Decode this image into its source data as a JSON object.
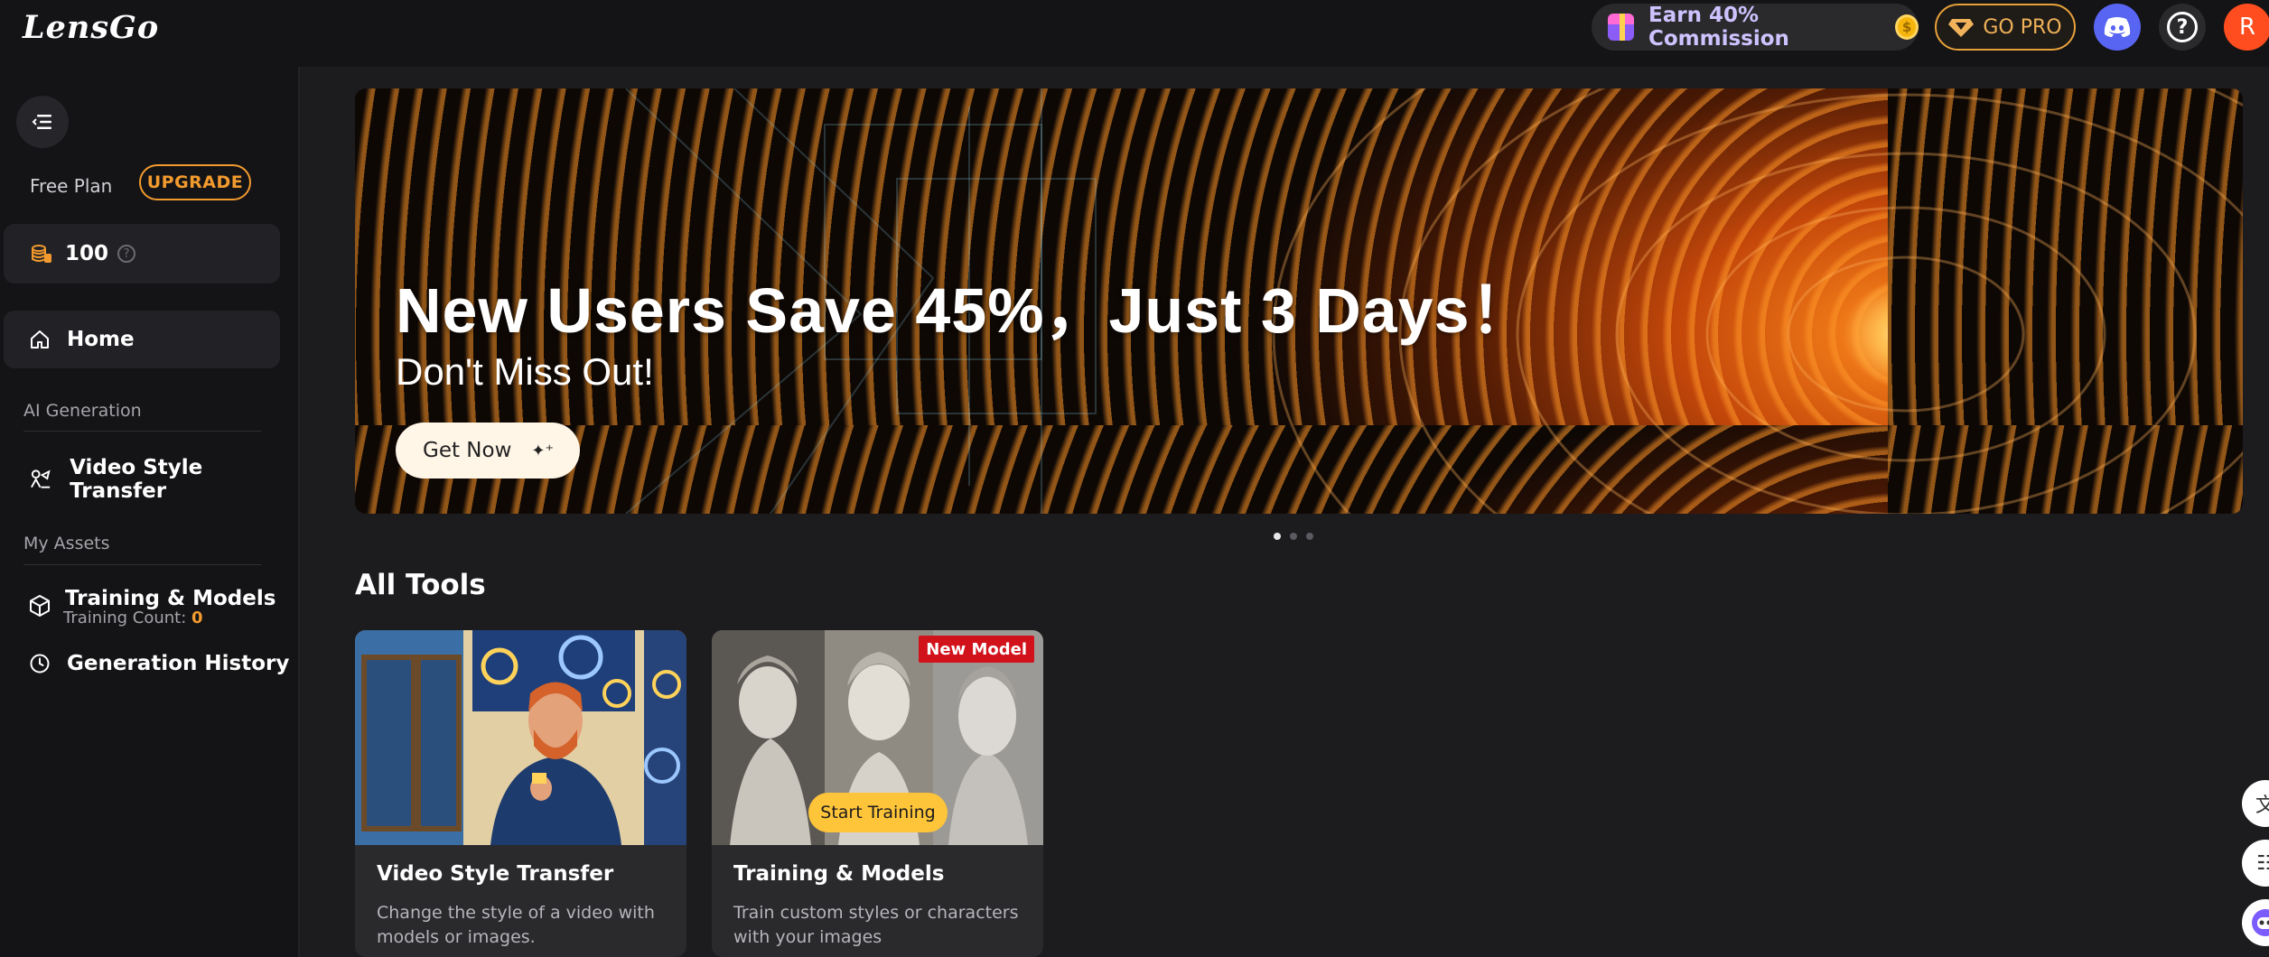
{
  "header": {
    "logo": "LensGo",
    "earn_label": "Earn 40% Commission",
    "gopro_label": "GO PRO",
    "avatar_initial": "R"
  },
  "sidebar": {
    "plan_label": "Free Plan",
    "upgrade_label": "UPGRADE",
    "credits": "100",
    "home_label": "Home",
    "section_ai": "AI Generation",
    "video_style_label": "Video Style Transfer",
    "section_assets": "My Assets",
    "training_label": "Training & Models",
    "training_count_label": "Training Count:",
    "training_count": "0",
    "history_label": "Generation History"
  },
  "banner": {
    "title": "New Users Save 45%，Just 3 Days！",
    "subtitle": "Don't Miss Out!",
    "cta_label": "Get Now",
    "slides": 3,
    "active_slide": 1
  },
  "tools": {
    "heading": "All Tools",
    "cards": [
      {
        "title": "Video Style Transfer",
        "description": "Change the style of a video with models or images."
      },
      {
        "title": "Training & Models",
        "description": "Train custom styles or characters with your images",
        "badge": "New Model",
        "overlay_button": "Start Training"
      }
    ]
  },
  "colors": {
    "accent_orange": "#f29a2e",
    "badge_red": "#d1121b",
    "discord": "#5865f2",
    "avatar": "#ff4d1f",
    "start_training": "#ffc53a"
  }
}
